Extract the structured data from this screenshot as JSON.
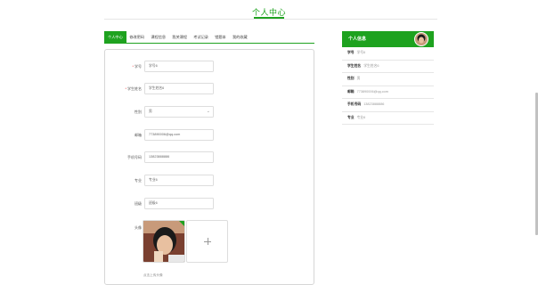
{
  "header": {
    "title": "个人中心"
  },
  "tabs": [
    {
      "label": "个人中心",
      "active": true
    },
    {
      "label": "修改密码"
    },
    {
      "label": "课程信息"
    },
    {
      "label": "我关课程"
    },
    {
      "label": "考试记录"
    },
    {
      "label": "错题本"
    },
    {
      "label": "我的收藏"
    }
  ],
  "form": {
    "fields": [
      {
        "label": "学号",
        "required": true,
        "value": "学号6"
      },
      {
        "label": "学生姓名",
        "required": true,
        "value": "学生姓名6"
      },
      {
        "label": "性别",
        "required": false,
        "value": "男",
        "type": "select"
      },
      {
        "label": "邮箱",
        "required": false,
        "value": "773890006@qq.com"
      },
      {
        "label": "手机号码",
        "required": false,
        "value": "13823888886"
      },
      {
        "label": "专业",
        "required": false,
        "value": "专业6"
      },
      {
        "label": "班级",
        "required": false,
        "value": "班级6"
      }
    ],
    "avatar_label": "头像",
    "upload_hint": "点击上传头像"
  },
  "sidebar": {
    "title": "个人信息",
    "rows": [
      {
        "key": "学号",
        "value": "学号6"
      },
      {
        "key": "学生姓名",
        "value": "学生姓名6"
      },
      {
        "key": "性别",
        "value": "男"
      },
      {
        "key": "邮箱",
        "value": "773890006@qq.com"
      },
      {
        "key": "手机号码",
        "value": "13823888886"
      },
      {
        "key": "专业",
        "value": "专业6"
      }
    ]
  },
  "colors": {
    "accent": "#1ea21f"
  }
}
